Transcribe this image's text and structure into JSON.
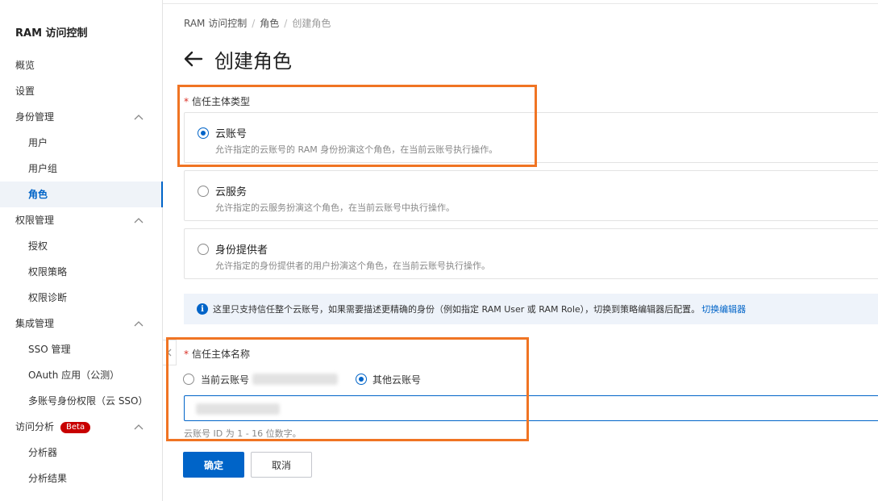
{
  "sidebar": {
    "title": "RAM 访问控制",
    "items": [
      {
        "label": "概览",
        "level": "top"
      },
      {
        "label": "设置",
        "level": "top"
      },
      {
        "label": "身份管理",
        "level": "top",
        "expandable": true
      },
      {
        "label": "用户",
        "level": "sub"
      },
      {
        "label": "用户组",
        "level": "sub"
      },
      {
        "label": "角色",
        "level": "sub",
        "active": true
      },
      {
        "label": "权限管理",
        "level": "top",
        "expandable": true
      },
      {
        "label": "授权",
        "level": "sub"
      },
      {
        "label": "权限策略",
        "level": "sub"
      },
      {
        "label": "权限诊断",
        "level": "sub"
      },
      {
        "label": "集成管理",
        "level": "top",
        "expandable": true
      },
      {
        "label": "SSO 管理",
        "level": "sub"
      },
      {
        "label": "OAuth 应用（公测）",
        "level": "sub"
      },
      {
        "label": "多账号身份权限（云 SSO）",
        "level": "sub"
      },
      {
        "label": "访问分析",
        "level": "top",
        "expandable": true,
        "badge": "Beta"
      },
      {
        "label": "分析器",
        "level": "sub"
      },
      {
        "label": "分析结果",
        "level": "sub"
      }
    ]
  },
  "breadcrumb": [
    "RAM 访问控制",
    "角色",
    "创建角色"
  ],
  "page": {
    "title": "创建角色"
  },
  "trust_type": {
    "label": "信任主体类型",
    "required_mark": "*",
    "options": [
      {
        "title": "云账号",
        "desc": "允许指定的云账号的 RAM 身份扮演这个角色，在当前云账号执行操作。",
        "checked": true
      },
      {
        "title": "云服务",
        "desc": "允许指定的云服务扮演这个角色，在当前云账号中执行操作。",
        "checked": false
      },
      {
        "title": "身份提供者",
        "desc": "允许指定的身份提供者的用户扮演这个角色，在当前云账号执行操作。",
        "checked": false
      }
    ]
  },
  "info": {
    "text": "这里只支持信任整个云账号，如果需要描述更精确的身份（例如指定 RAM User 或 RAM Role），切换到策略编辑器后配置。",
    "link": "切换编辑器"
  },
  "trust_name": {
    "label": "信任主体名称",
    "required_mark": "*",
    "current_account_label": "当前云账号",
    "other_account_label": "其他云账号",
    "selected": "other",
    "hint": "云账号 ID 为 1 - 16 位数字。"
  },
  "actions": {
    "confirm": "确定",
    "cancel": "取消"
  },
  "colors": {
    "primary": "#0064c8",
    "highlight": "#f07423",
    "required": "#d93026",
    "beta_badge": "#c80000"
  }
}
